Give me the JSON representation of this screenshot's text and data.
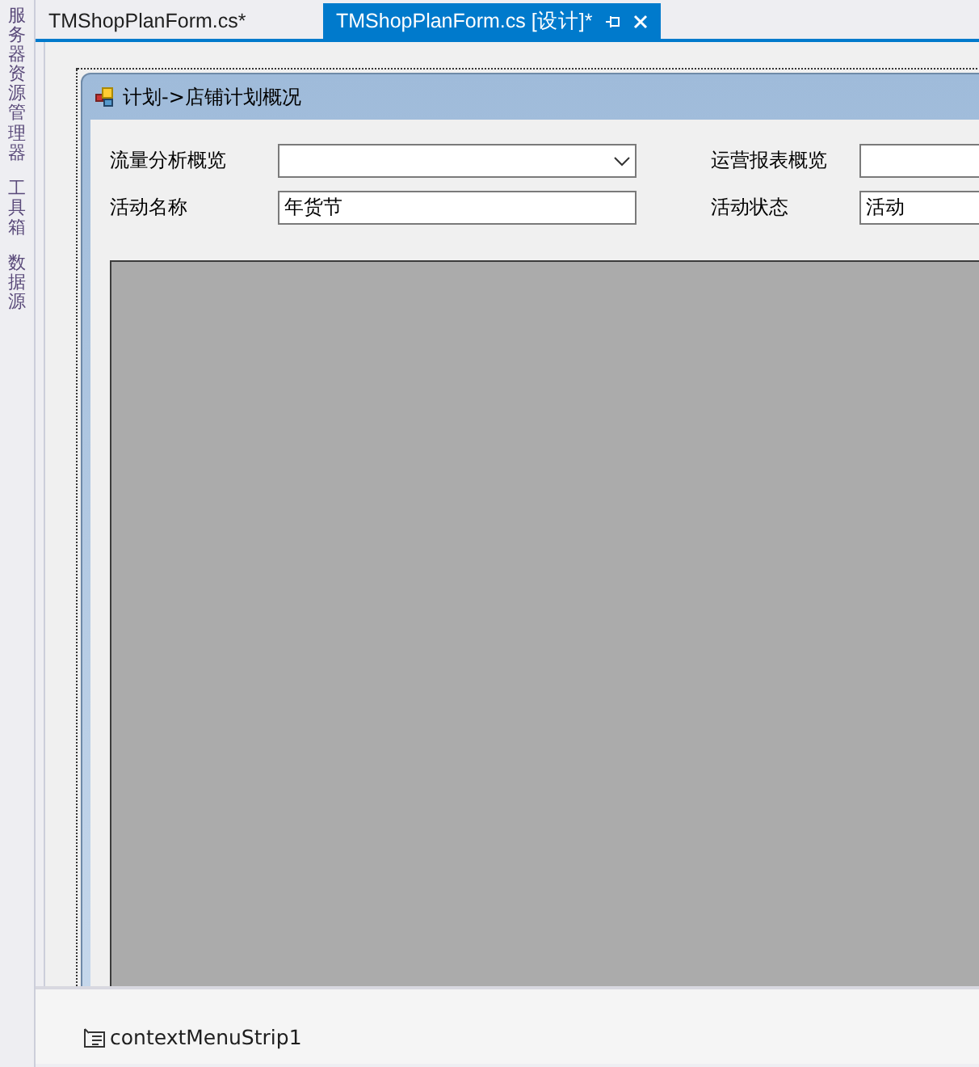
{
  "side_tabs": [
    {
      "label": "服务器资源管理器"
    },
    {
      "label": "工具箱"
    },
    {
      "label": "数据源"
    }
  ],
  "doc_tabs": [
    {
      "label": "TMShopPlanForm.cs*",
      "selected": false
    },
    {
      "label": "TMShopPlanForm.cs [设计]*",
      "selected": true
    }
  ],
  "form": {
    "title": "计划->店铺计划概况",
    "fields": [
      {
        "label": "流量分析概览",
        "kind": "combo"
      },
      {
        "label": "运营报表概览",
        "kind": "text"
      },
      {
        "label": "活动名称",
        "kind": "text",
        "value": "年货节"
      },
      {
        "label": "活动状态",
        "kind": "text",
        "value": "活动"
      }
    ]
  },
  "tray": {
    "components": [
      {
        "label": "contextMenuStrip1"
      }
    ]
  }
}
